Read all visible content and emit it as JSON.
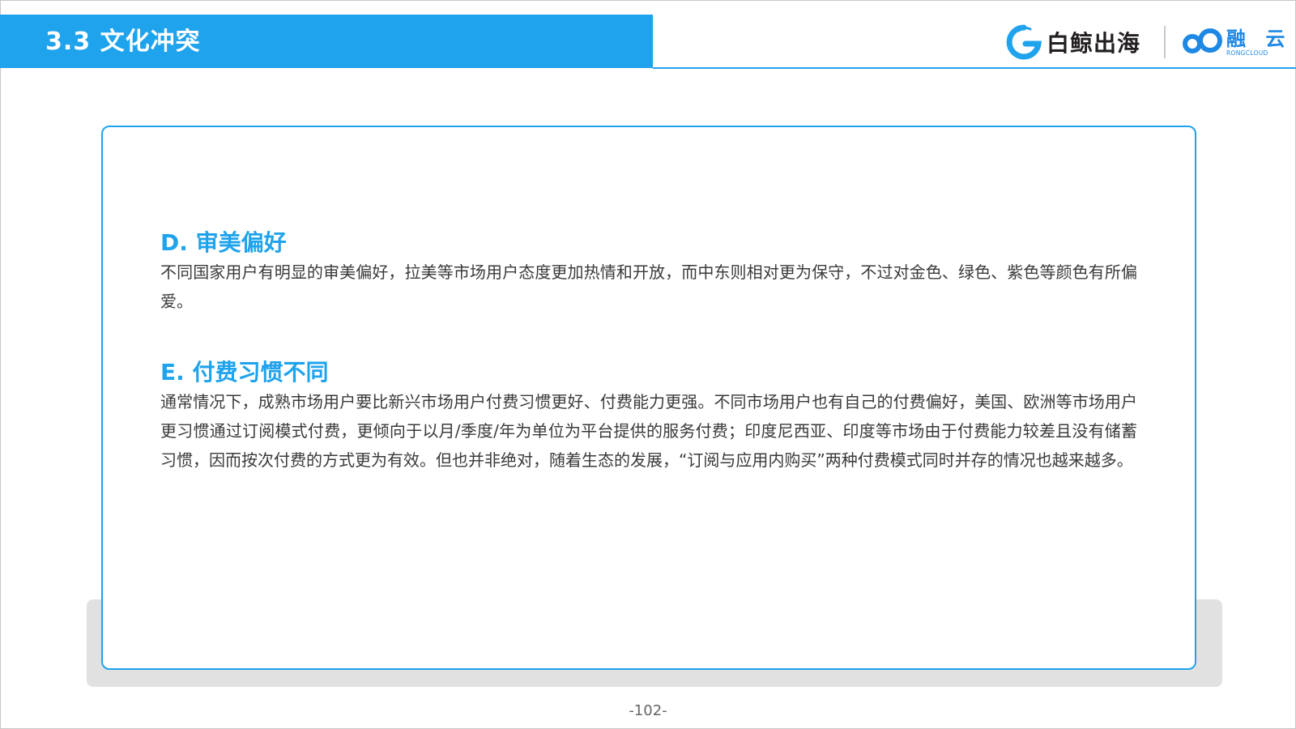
{
  "header": {
    "title": "3.3 文化冲突",
    "accent_color": "#1fa3ec"
  },
  "logos": {
    "baijing": {
      "text": "白鲸出海",
      "icon": "baijing-whale-icon"
    },
    "rongcloud": {
      "text_cn": "融 云",
      "text_en": "RONGCLOUD",
      "icon": "rongcloud-infinity-icon"
    }
  },
  "sections": [
    {
      "heading": "D. 审美偏好",
      "body": "不同国家用户有明显的审美偏好，拉美等市场用户态度更加热情和开放，而中东则相对更为保守，不过对金色、绿色、紫色等颜色有所偏爱。"
    },
    {
      "heading": "E. 付费习惯不同",
      "body": "通常情况下，成熟市场用户要比新兴市场用户付费习惯更好、付费能力更强。不同市场用户也有自己的付费偏好，美国、欧洲等市场用户更习惯通过订阅模式付费，更倾向于以月/季度/年为单位为平台提供的服务付费；印度尼西亚、印度等市场由于付费能力较差且没有储蓄习惯，因而按次付费的方式更为有效。但也并非绝对，随着生态的发展，“订阅与应用内购买”两种付费模式同时并存的情况也越来越多。"
    }
  ],
  "footer": {
    "page_number": "-102-"
  }
}
